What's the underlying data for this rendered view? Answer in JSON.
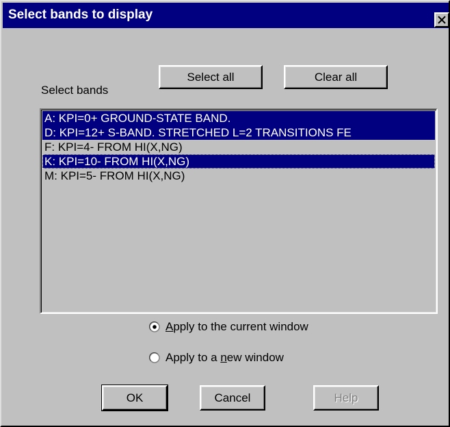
{
  "dialog": {
    "title": "Select bands to display",
    "close_glyph": "✕"
  },
  "buttons": {
    "select_all": "Select all",
    "clear_all": "Clear all",
    "ok": "OK",
    "cancel": "Cancel",
    "help": "Help"
  },
  "select_bands_label": "Select bands",
  "bands": [
    {
      "label": "A: KPI=0+ GROUND-STATE BAND.",
      "selected": true
    },
    {
      "label": "D: KPI=12+ S-BAND. STRETCHED L=2 TRANSITIONS FE",
      "selected": true
    },
    {
      "label": "F: KPI=4- FROM HI(X,NG)",
      "selected": false
    },
    {
      "label": "K: KPI=10- FROM HI(X,NG)",
      "selected": true,
      "focused": true
    },
    {
      "label": "M: KPI=5- FROM HI(X,NG)",
      "selected": false
    }
  ],
  "apply_options": {
    "current": {
      "prefix": "",
      "mnemonic": "A",
      "suffix": "pply to the current window",
      "checked": true
    },
    "new": {
      "prefix": "Apply to a ",
      "mnemonic": "n",
      "suffix": "ew window",
      "checked": false
    }
  },
  "colors": {
    "dialog_face": "#c0c0c0",
    "title_bar": "#000080",
    "selection": "#000080"
  },
  "icons": {
    "close": "close-icon",
    "radio_checked": "radio-checked-icon",
    "radio_unchecked": "radio-unchecked-icon"
  }
}
